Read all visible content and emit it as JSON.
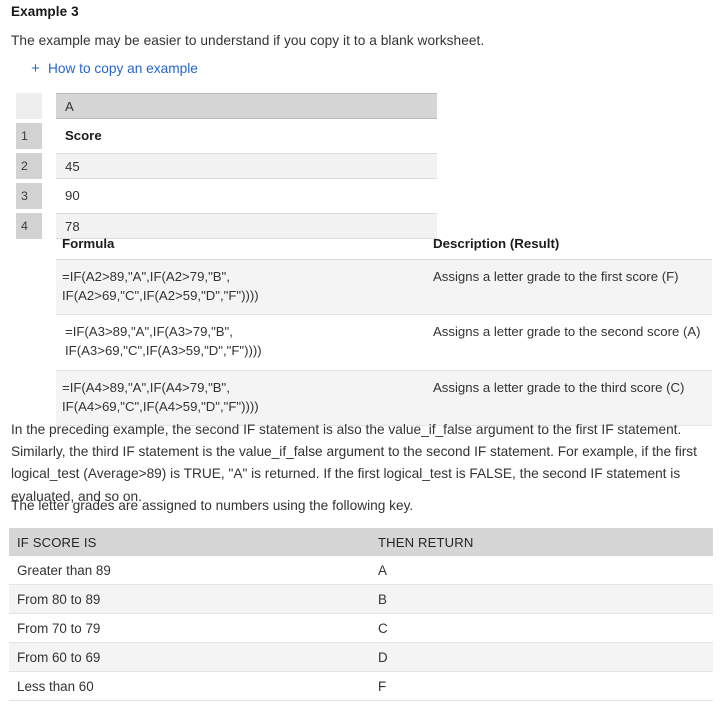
{
  "heading": "Example 3",
  "intro_text": "The example may be easier to understand if you copy it to a blank worksheet.",
  "expander": {
    "icon": "plus-icon",
    "plus": "+",
    "label": "How to copy an example"
  },
  "spreadsheet": {
    "column_header": "A",
    "row_labels": [
      "1",
      "2",
      "3",
      "4"
    ],
    "rows": [
      {
        "row": "1",
        "value": "Score"
      },
      {
        "row": "2",
        "value": "45"
      },
      {
        "row": "3",
        "value": "90"
      },
      {
        "row": "4",
        "value": "78"
      }
    ]
  },
  "formula_table": {
    "headers": {
      "formula": "Formula",
      "description": "Description (Result)"
    },
    "rows": [
      {
        "formula_line1": "=IF(A2>89,\"A\",IF(A2>79,\"B\",",
        "formula_line2": "IF(A2>69,\"C\",IF(A2>59,\"D\",\"F\"))))",
        "description": "Assigns a letter grade to the first score (F)"
      },
      {
        "formula_line1": "=IF(A3>89,\"A\",IF(A3>79,\"B\",",
        "formula_line2": "IF(A3>69,\"C\",IF(A3>59,\"D\",\"F\"))))",
        "description": "Assigns a letter grade to the second score (A)"
      },
      {
        "formula_line1": "=IF(A4>89,\"A\",IF(A4>79,\"B\",",
        "formula_line2": "IF(A4>69,\"C\",IF(A4>59,\"D\",\"F\"))))",
        "description": "Assigns a letter grade to the third score (C)"
      }
    ]
  },
  "paragraph_1": "In the preceding example, the second IF statement is also the value_if_false argument to the first IF statement. Similarly, the third IF statement is the value_if_false argument to the second IF statement. For example, if the first logical_test (Average>89) is TRUE, \"A\" is returned. If the first logical_test is FALSE, the second IF statement is evaluated, and so on.",
  "paragraph_2": "The letter grades are assigned to numbers using the following key.",
  "grade_table": {
    "headers": {
      "condition": "IF SCORE IS",
      "result": "THEN RETURN"
    },
    "rows": [
      {
        "condition": "Greater than 89",
        "result": "A"
      },
      {
        "condition": "From 80 to 89",
        "result": "B"
      },
      {
        "condition": "From 70 to 79",
        "result": "C"
      },
      {
        "condition": "From 60 to 69",
        "result": "D"
      },
      {
        "condition": "Less than 60",
        "result": "F"
      }
    ]
  },
  "colors": {
    "link": "#2564cf",
    "header_fill": "#d6d6d6",
    "row_alt": "#f4f4f4",
    "text": "#333333",
    "row_gutter": "#d2d2d2"
  }
}
